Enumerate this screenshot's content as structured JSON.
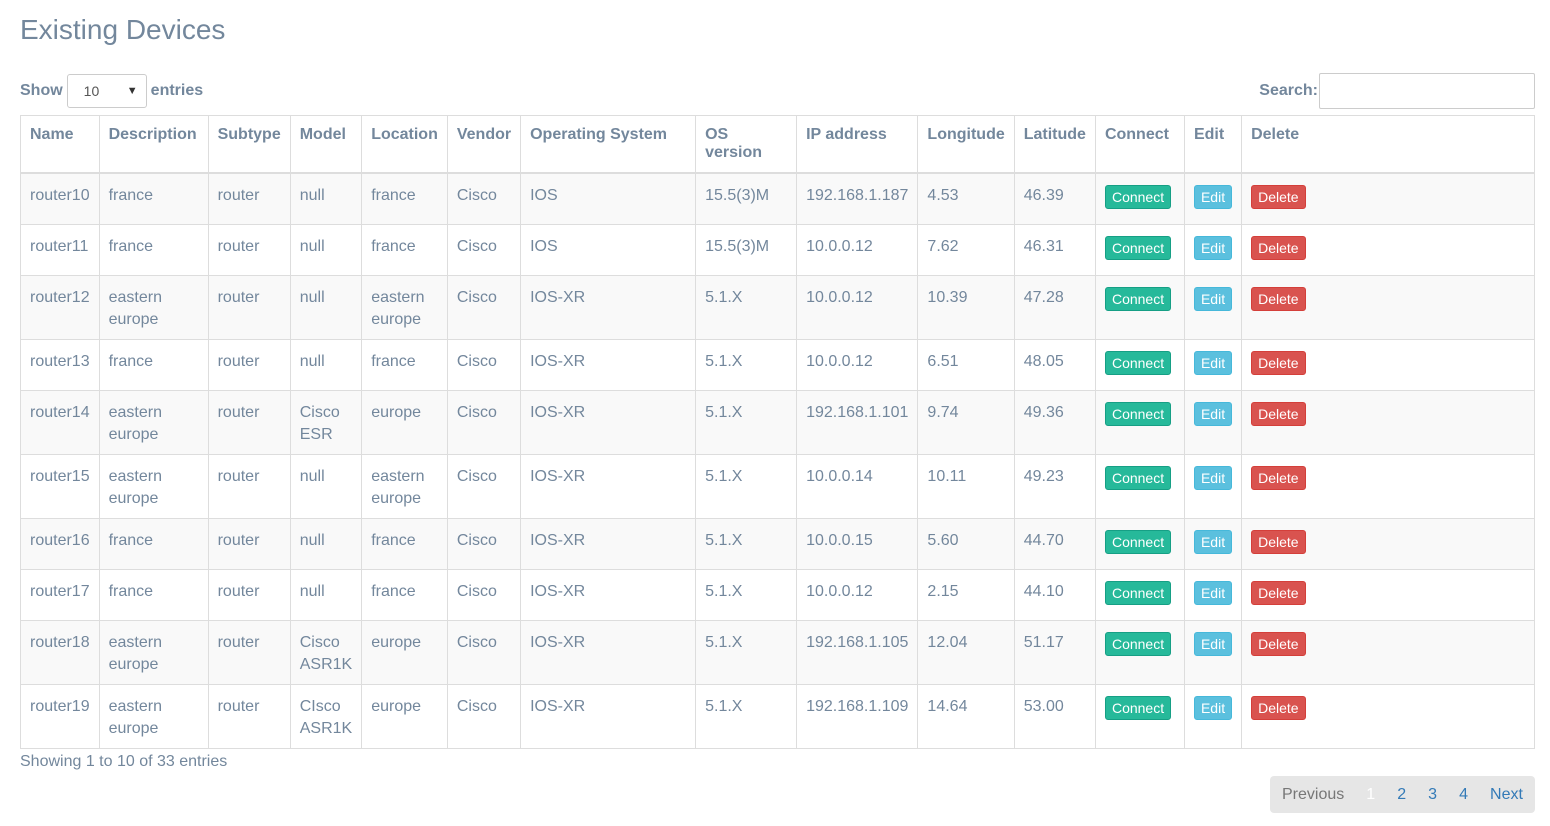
{
  "page": {
    "title": "Existing Devices"
  },
  "controls": {
    "show_label": "Show",
    "entries_value": "10",
    "entries_label": "entries",
    "search_label": "Search:",
    "search_value": ""
  },
  "table": {
    "headers": [
      "Name",
      "Description",
      "Subtype",
      "Model",
      "Location",
      "Vendor",
      "Operating System",
      "OS version",
      "IP address",
      "Longitude",
      "Latitude",
      "Connect",
      "Edit",
      "Delete"
    ],
    "rows": [
      {
        "name": "router10",
        "description": "france",
        "subtype": "router",
        "model": "null",
        "location": "france",
        "vendor": "Cisco",
        "os": "IOS",
        "os_version": "15.5(3)M",
        "ip": "192.168.1.187",
        "longitude": "4.53",
        "latitude": "46.39"
      },
      {
        "name": "router11",
        "description": "france",
        "subtype": "router",
        "model": "null",
        "location": "france",
        "vendor": "Cisco",
        "os": "IOS",
        "os_version": "15.5(3)M",
        "ip": "10.0.0.12",
        "longitude": "7.62",
        "latitude": "46.31"
      },
      {
        "name": "router12",
        "description": "eastern europe",
        "subtype": "router",
        "model": "null",
        "location": "eastern europe",
        "vendor": "Cisco",
        "os": "IOS-XR",
        "os_version": "5.1.X",
        "ip": "10.0.0.12",
        "longitude": "10.39",
        "latitude": "47.28"
      },
      {
        "name": "router13",
        "description": "france",
        "subtype": "router",
        "model": "null",
        "location": "france",
        "vendor": "Cisco",
        "os": "IOS-XR",
        "os_version": "5.1.X",
        "ip": "10.0.0.12",
        "longitude": "6.51",
        "latitude": "48.05"
      },
      {
        "name": "router14",
        "description": "eastern europe",
        "subtype": "router",
        "model": "Cisco ESR",
        "location": "europe",
        "vendor": "Cisco",
        "os": "IOS-XR",
        "os_version": "5.1.X",
        "ip": "192.168.1.101",
        "longitude": "9.74",
        "latitude": "49.36"
      },
      {
        "name": "router15",
        "description": "eastern europe",
        "subtype": "router",
        "model": "null",
        "location": "eastern europe",
        "vendor": "Cisco",
        "os": "IOS-XR",
        "os_version": "5.1.X",
        "ip": "10.0.0.14",
        "longitude": "10.11",
        "latitude": "49.23"
      },
      {
        "name": "router16",
        "description": "france",
        "subtype": "router",
        "model": "null",
        "location": "france",
        "vendor": "Cisco",
        "os": "IOS-XR",
        "os_version": "5.1.X",
        "ip": "10.0.0.15",
        "longitude": "5.60",
        "latitude": "44.70"
      },
      {
        "name": "router17",
        "description": "france",
        "subtype": "router",
        "model": "null",
        "location": "france",
        "vendor": "Cisco",
        "os": "IOS-XR",
        "os_version": "5.1.X",
        "ip": "10.0.0.12",
        "longitude": "2.15",
        "latitude": "44.10"
      },
      {
        "name": "router18",
        "description": "eastern europe",
        "subtype": "router",
        "model": "Cisco ASR1K",
        "location": "europe",
        "vendor": "Cisco",
        "os": "IOS-XR",
        "os_version": "5.1.X",
        "ip": "192.168.1.105",
        "longitude": "12.04",
        "latitude": "51.17"
      },
      {
        "name": "router19",
        "description": "eastern europe",
        "subtype": "router",
        "model": "CIsco ASR1K",
        "location": "europe",
        "vendor": "Cisco",
        "os": "IOS-XR",
        "os_version": "5.1.X",
        "ip": "192.168.1.109",
        "longitude": "14.64",
        "latitude": "53.00"
      }
    ],
    "connect_label": "Connect",
    "edit_label": "Edit",
    "delete_label": "Delete"
  },
  "footer": {
    "info": "Showing 1 to 10 of 33 entries",
    "previous": "Previous",
    "pages": [
      "1",
      "2",
      "3",
      "4"
    ],
    "current_page": "1",
    "next": "Next"
  },
  "colors": {
    "connect": "#26b99a",
    "edit": "#5bc0de",
    "delete": "#d9534f",
    "text": "#73879c",
    "link": "#337ab7"
  }
}
